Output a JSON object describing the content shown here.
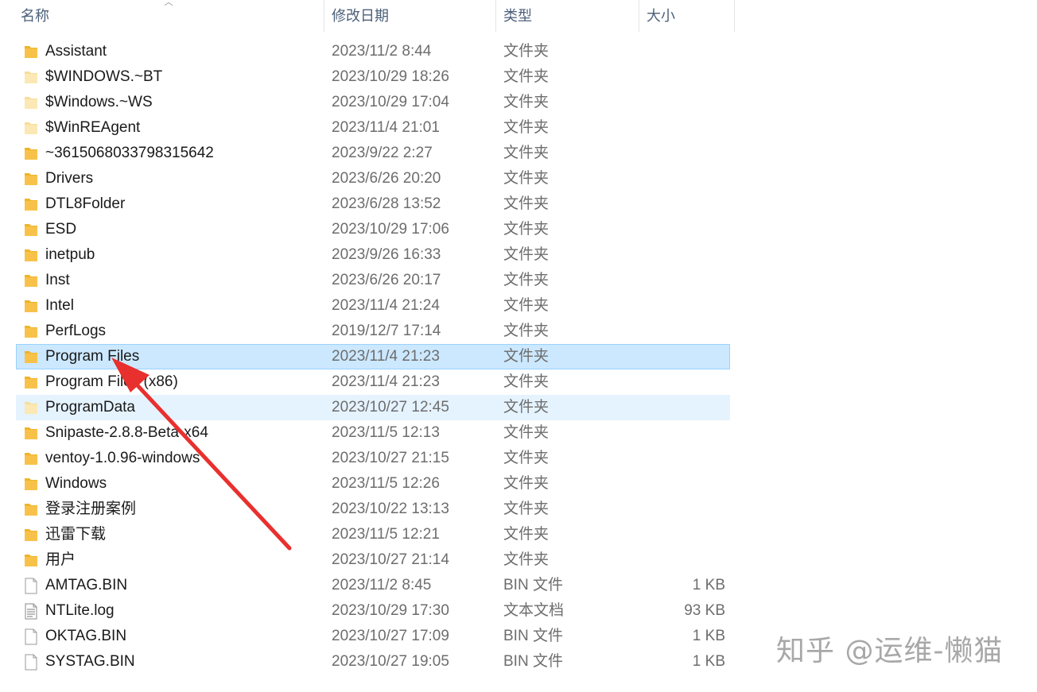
{
  "columns": {
    "name": "名称",
    "date": "修改日期",
    "type": "类型",
    "size": "大小"
  },
  "files": [
    {
      "name": "Assistant",
      "date": "2023/11/2 8:44",
      "type": "文件夹",
      "size": "",
      "icon": "folder-icon",
      "state": ""
    },
    {
      "name": "$WINDOWS.~BT",
      "date": "2023/10/29 18:26",
      "type": "文件夹",
      "size": "",
      "icon": "folder-hidden-icon",
      "state": ""
    },
    {
      "name": "$Windows.~WS",
      "date": "2023/10/29 17:04",
      "type": "文件夹",
      "size": "",
      "icon": "folder-hidden-icon",
      "state": ""
    },
    {
      "name": "$WinREAgent",
      "date": "2023/11/4 21:01",
      "type": "文件夹",
      "size": "",
      "icon": "folder-hidden-icon",
      "state": ""
    },
    {
      "name": "~3615068033798315642",
      "date": "2023/9/22 2:27",
      "type": "文件夹",
      "size": "",
      "icon": "folder-icon",
      "state": ""
    },
    {
      "name": "Drivers",
      "date": "2023/6/26 20:20",
      "type": "文件夹",
      "size": "",
      "icon": "folder-icon",
      "state": ""
    },
    {
      "name": "DTL8Folder",
      "date": "2023/6/28 13:52",
      "type": "文件夹",
      "size": "",
      "icon": "folder-icon",
      "state": ""
    },
    {
      "name": "ESD",
      "date": "2023/10/29 17:06",
      "type": "文件夹",
      "size": "",
      "icon": "folder-icon",
      "state": ""
    },
    {
      "name": "inetpub",
      "date": "2023/9/26 16:33",
      "type": "文件夹",
      "size": "",
      "icon": "folder-icon",
      "state": ""
    },
    {
      "name": "Inst",
      "date": "2023/6/26 20:17",
      "type": "文件夹",
      "size": "",
      "icon": "folder-icon",
      "state": ""
    },
    {
      "name": "Intel",
      "date": "2023/11/4 21:24",
      "type": "文件夹",
      "size": "",
      "icon": "folder-icon",
      "state": ""
    },
    {
      "name": "PerfLogs",
      "date": "2019/12/7 17:14",
      "type": "文件夹",
      "size": "",
      "icon": "folder-icon",
      "state": ""
    },
    {
      "name": "Program Files",
      "date": "2023/11/4 21:23",
      "type": "文件夹",
      "size": "",
      "icon": "folder-icon",
      "state": "selected"
    },
    {
      "name": "Program Files (x86)",
      "date": "2023/11/4 21:23",
      "type": "文件夹",
      "size": "",
      "icon": "folder-icon",
      "state": ""
    },
    {
      "name": "ProgramData",
      "date": "2023/10/27 12:45",
      "type": "文件夹",
      "size": "",
      "icon": "folder-hidden-icon",
      "state": "hover"
    },
    {
      "name": "Snipaste-2.8.8-Beta-x64",
      "date": "2023/11/5 12:13",
      "type": "文件夹",
      "size": "",
      "icon": "folder-icon",
      "state": ""
    },
    {
      "name": "ventoy-1.0.96-windows",
      "date": "2023/10/27 21:15",
      "type": "文件夹",
      "size": "",
      "icon": "folder-icon",
      "state": ""
    },
    {
      "name": "Windows",
      "date": "2023/11/5 12:26",
      "type": "文件夹",
      "size": "",
      "icon": "folder-icon",
      "state": ""
    },
    {
      "name": "登录注册案例",
      "date": "2023/10/22 13:13",
      "type": "文件夹",
      "size": "",
      "icon": "folder-icon",
      "state": ""
    },
    {
      "name": "迅雷下载",
      "date": "2023/11/5 12:21",
      "type": "文件夹",
      "size": "",
      "icon": "folder-icon",
      "state": ""
    },
    {
      "name": "用户",
      "date": "2023/10/27 21:14",
      "type": "文件夹",
      "size": "",
      "icon": "folder-icon",
      "state": ""
    },
    {
      "name": "AMTAG.BIN",
      "date": "2023/11/2 8:45",
      "type": "BIN 文件",
      "size": "1 KB",
      "icon": "file-icon",
      "state": ""
    },
    {
      "name": "NTLite.log",
      "date": "2023/10/29 17:30",
      "type": "文本文档",
      "size": "93 KB",
      "icon": "text-file-icon",
      "state": ""
    },
    {
      "name": "OKTAG.BIN",
      "date": "2023/10/27 17:09",
      "type": "BIN 文件",
      "size": "1 KB",
      "icon": "file-icon",
      "state": ""
    },
    {
      "name": "SYSTAG.BIN",
      "date": "2023/10/27 19:05",
      "type": "BIN 文件",
      "size": "1 KB",
      "icon": "file-icon",
      "state": ""
    }
  ],
  "watermark": "知乎 @运维-懒猫",
  "colors": {
    "selected_bg": "#cce8ff",
    "hover_bg": "#e5f3ff",
    "arrow": "#e8302e",
    "folder": "#f8c24a"
  }
}
